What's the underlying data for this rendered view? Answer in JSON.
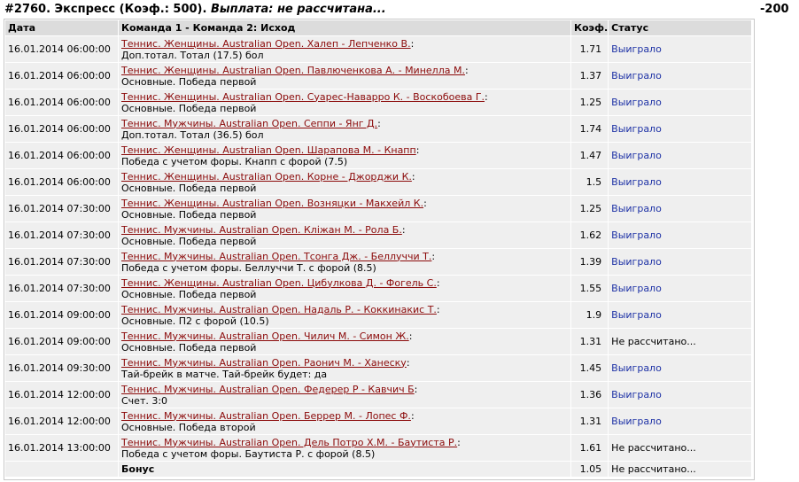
{
  "header": {
    "id_type": "#2760. Экспресс (Коэф.: 500).",
    "payout": "Выплата: не рассчитана...",
    "amount": "-200"
  },
  "columns": {
    "date": "Дата",
    "match": "Команда 1 - Команда 2: Исход",
    "odds": "Коэф.",
    "status": "Статус"
  },
  "rows": [
    {
      "date": "16.01.2014 06:00:00",
      "event": "Теннис. Женщины. Australian Open. Халеп - Лепченко В.",
      "outcome": "Доп.тотал. Тотал (17.5) бол",
      "odds": "1.71",
      "status": "Выиграло"
    },
    {
      "date": "16.01.2014 06:00:00",
      "event": "Теннис. Женщины. Australian Open. Павлюченкова А. - Минелла М.",
      "outcome": "Основные. Победа первой",
      "odds": "1.37",
      "status": "Выиграло"
    },
    {
      "date": "16.01.2014 06:00:00",
      "event": "Теннис. Женщины. Australian Open. Суарес-Наварро К. - Воскобоева Г.",
      "outcome": "Основные. Победа первой",
      "odds": "1.25",
      "status": "Выиграло"
    },
    {
      "date": "16.01.2014 06:00:00",
      "event": "Теннис. Мужчины. Australian Open. Сеппи - Янг Д.",
      "outcome": "Доп.тотал. Тотал (36.5) бол",
      "odds": "1.74",
      "status": "Выиграло"
    },
    {
      "date": "16.01.2014 06:00:00",
      "event": "Теннис. Женщины. Australian Open. Шарапова М. - Кнапп",
      "outcome": "Победа с учетом форы. Кнапп с форой (7.5)",
      "odds": "1.47",
      "status": "Выиграло"
    },
    {
      "date": "16.01.2014 06:00:00",
      "event": "Теннис. Женщины. Australian Open. Корне - Джорджи К.",
      "outcome": "Основные. Победа первой",
      "odds": "1.5",
      "status": "Выиграло"
    },
    {
      "date": "16.01.2014 07:30:00",
      "event": "Теннис. Женщины. Australian Open. Возняцки - Макхейл К.",
      "outcome": "Основные. Победа первой",
      "odds": "1.25",
      "status": "Выиграло"
    },
    {
      "date": "16.01.2014 07:30:00",
      "event": "Теннис. Мужчины. Australian Open. Кліжан М. - Рола Б.",
      "outcome": "Основные. Победа первой",
      "odds": "1.62",
      "status": "Выиграло"
    },
    {
      "date": "16.01.2014 07:30:00",
      "event": "Теннис. Мужчины. Australian Open. Тсонга Дж. - Беллуччи Т.",
      "outcome": "Победа с учетом форы. Беллуччи Т. с форой (8.5)",
      "odds": "1.39",
      "status": "Выиграло"
    },
    {
      "date": "16.01.2014 07:30:00",
      "event": "Теннис. Женщины. Australian Open. Цибулкова Д. - Фогель С.",
      "outcome": "Основные. Победа первой",
      "odds": "1.55",
      "status": "Выиграло"
    },
    {
      "date": "16.01.2014 09:00:00",
      "event": "Теннис. Мужчины. Australian Open. Надаль Р. - Коккинакис Т.",
      "outcome": "Основные. П2 с форой (10.5)",
      "odds": "1.9",
      "status": "Выиграло"
    },
    {
      "date": "16.01.2014 09:00:00",
      "event": "Теннис. Мужчины. Australian Open. Чилич М. - Симон Ж.",
      "outcome": "Основные. Победа первой",
      "odds": "1.31",
      "status": "Не рассчитано..."
    },
    {
      "date": "16.01.2014 09:30:00",
      "event": "Теннис. Мужчины. Australian Open. Раонич М. - Ханеску",
      "outcome": "Тай-брейк в матче. Тай-брейк будет: да",
      "odds": "1.45",
      "status": "Выиграло"
    },
    {
      "date": "16.01.2014 12:00:00",
      "event": "Теннис. Мужчины. Australian Open. Федерер Р - Кавчич Б",
      "outcome": "Счет. 3:0",
      "odds": "1.36",
      "status": "Выиграло"
    },
    {
      "date": "16.01.2014 12:00:00",
      "event": "Теннис. Мужчины. Australian Open. Беррер М. - Лопес Ф.",
      "outcome": "Основные. Победа второй",
      "odds": "1.31",
      "status": "Выиграло"
    },
    {
      "date": "16.01.2014 13:00:00",
      "event": "Теннис. Мужчины. Australian Open. Дель Потро Х.М. - Баутиста Р.",
      "outcome": "Победа с учетом форы. Баутиста Р. с форой (8.5)",
      "odds": "1.61",
      "status": "Не рассчитано..."
    }
  ],
  "bonus": {
    "label": "Бонус",
    "odds": "1.05",
    "status": "Не рассчитано..."
  },
  "colors": {
    "link": "#8b0a0a",
    "won": "#1f33a6",
    "header_bg": "#dcdcdc",
    "row_bg": "#efefef"
  }
}
